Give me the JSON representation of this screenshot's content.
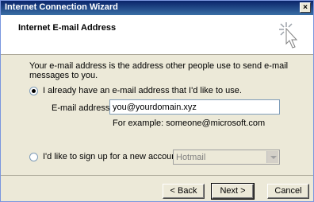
{
  "window": {
    "title": "Internet Connection Wizard",
    "close_label": "×"
  },
  "header": {
    "title": "Internet E-mail Address",
    "icon": "wizard-wand-icon"
  },
  "intro_text": "Your e-mail address is the address other people use to send e-mail messages to you.",
  "option_existing": {
    "label": "I already have an e-mail address that I'd like to use.",
    "selected": true
  },
  "email": {
    "label": "E-mail address:",
    "value": "you@yourdomain.xyz",
    "example": "For example: someone@microsoft.com"
  },
  "option_signup": {
    "label": "I'd like to sign up for a new account from:",
    "selected": false,
    "provider": "Hotmail"
  },
  "buttons": {
    "back": "< Back",
    "next": "Next >",
    "cancel": "Cancel"
  }
}
